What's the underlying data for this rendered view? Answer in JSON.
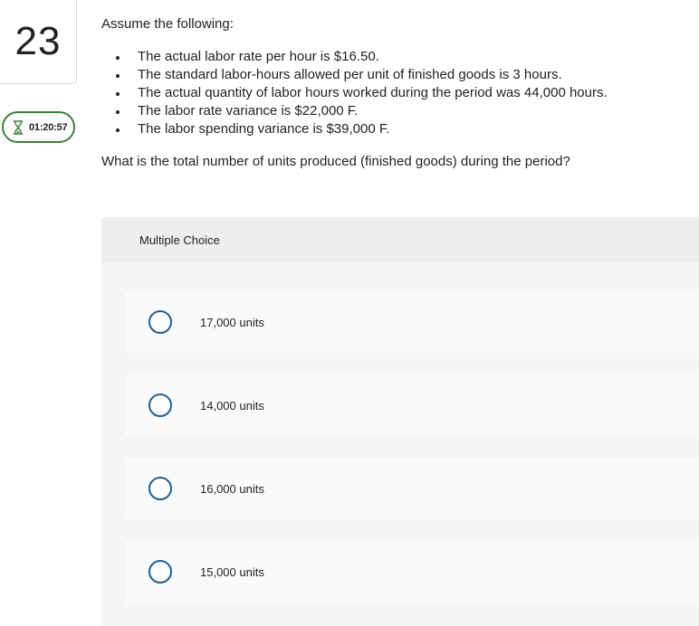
{
  "question_number": "23",
  "timer": {
    "icon": "hourglass-icon",
    "time": "01:20:57",
    "color": "#3c7d39"
  },
  "question": {
    "intro": "Assume the following:",
    "facts": [
      "The actual labor rate per hour is $16.50.",
      "The standard labor-hours allowed per unit of finished goods is 3 hours.",
      "The actual quantity of labor hours worked during the period was 44,000 hours.",
      "The labor rate variance is $22,000 F.",
      "The labor spending variance is $39,000 F."
    ],
    "prompt": "What is the total number of units produced (finished goods) during the period?"
  },
  "multiple_choice": {
    "header": "Multiple Choice",
    "radio_color": "#1f5f93",
    "options": [
      "17,000 units",
      "14,000 units",
      "16,000 units",
      "15,000 units"
    ]
  }
}
